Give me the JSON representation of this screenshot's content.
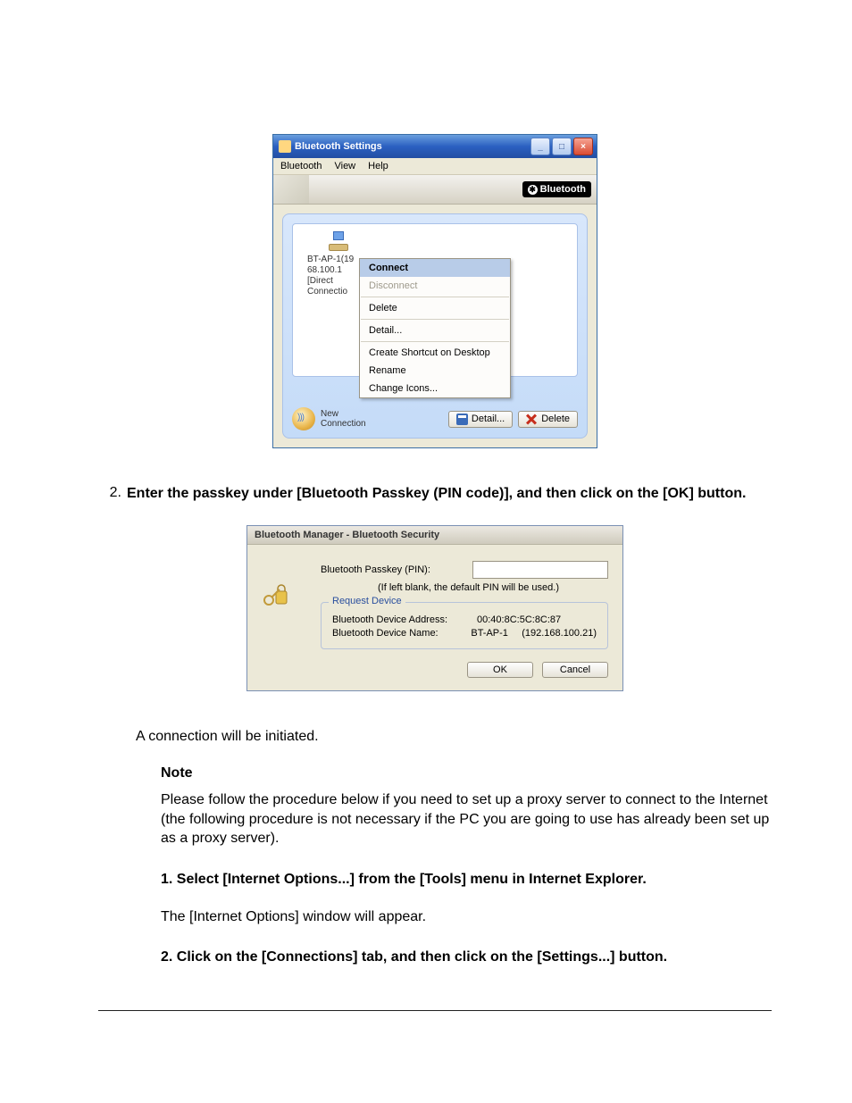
{
  "bt_window": {
    "title": "Bluetooth Settings",
    "menu": {
      "bluetooth": "Bluetooth",
      "view": "View",
      "help": "Help"
    },
    "logo_text": "Bluetooth",
    "device_label": "BT-AP-1(19\n68.100.1\n[Direct\nConnectio",
    "context_menu": {
      "connect": "Connect",
      "disconnect": "Disconnect",
      "delete": "Delete",
      "detail": "Detail...",
      "create_shortcut": "Create Shortcut on Desktop",
      "rename": "Rename",
      "change_icons": "Change Icons..."
    },
    "new_connection": "New\nConnection",
    "btn_detail": "Detail...",
    "btn_delete": "Delete"
  },
  "instruction": {
    "number": "2.",
    "text": "Enter the passkey under [Bluetooth Passkey (PIN code)], and then click on the [OK] button."
  },
  "sec_window": {
    "title": "Bluetooth Manager - Bluetooth Security",
    "passkey_label": "Bluetooth Passkey (PIN):",
    "hint": "(If left blank, the default PIN will be used.)",
    "group_label": "Request Device",
    "addr_label": "Bluetooth Device Address:",
    "addr_value": "00:40:8C:5C:8C:87",
    "name_label": "Bluetooth Device Name:",
    "name_value": "BT-AP-1     (192.168.100.21)",
    "ok": "OK",
    "cancel": "Cancel"
  },
  "body": {
    "initiated": "A connection will be initiated.",
    "note_heading": "Note",
    "note_text": "Please follow the procedure below if you need to set up a proxy server to connect to the Internet (the following procedure is not necessary if the PC you are going to use has already been set up as a proxy server).",
    "step1": "1. Select [Internet Options...] from the [Tools] menu in Internet Explorer.",
    "step1_after": "The [Internet Options] window will appear.",
    "step2": "2. Click on the [Connections] tab, and then click on the [Settings...] button."
  }
}
